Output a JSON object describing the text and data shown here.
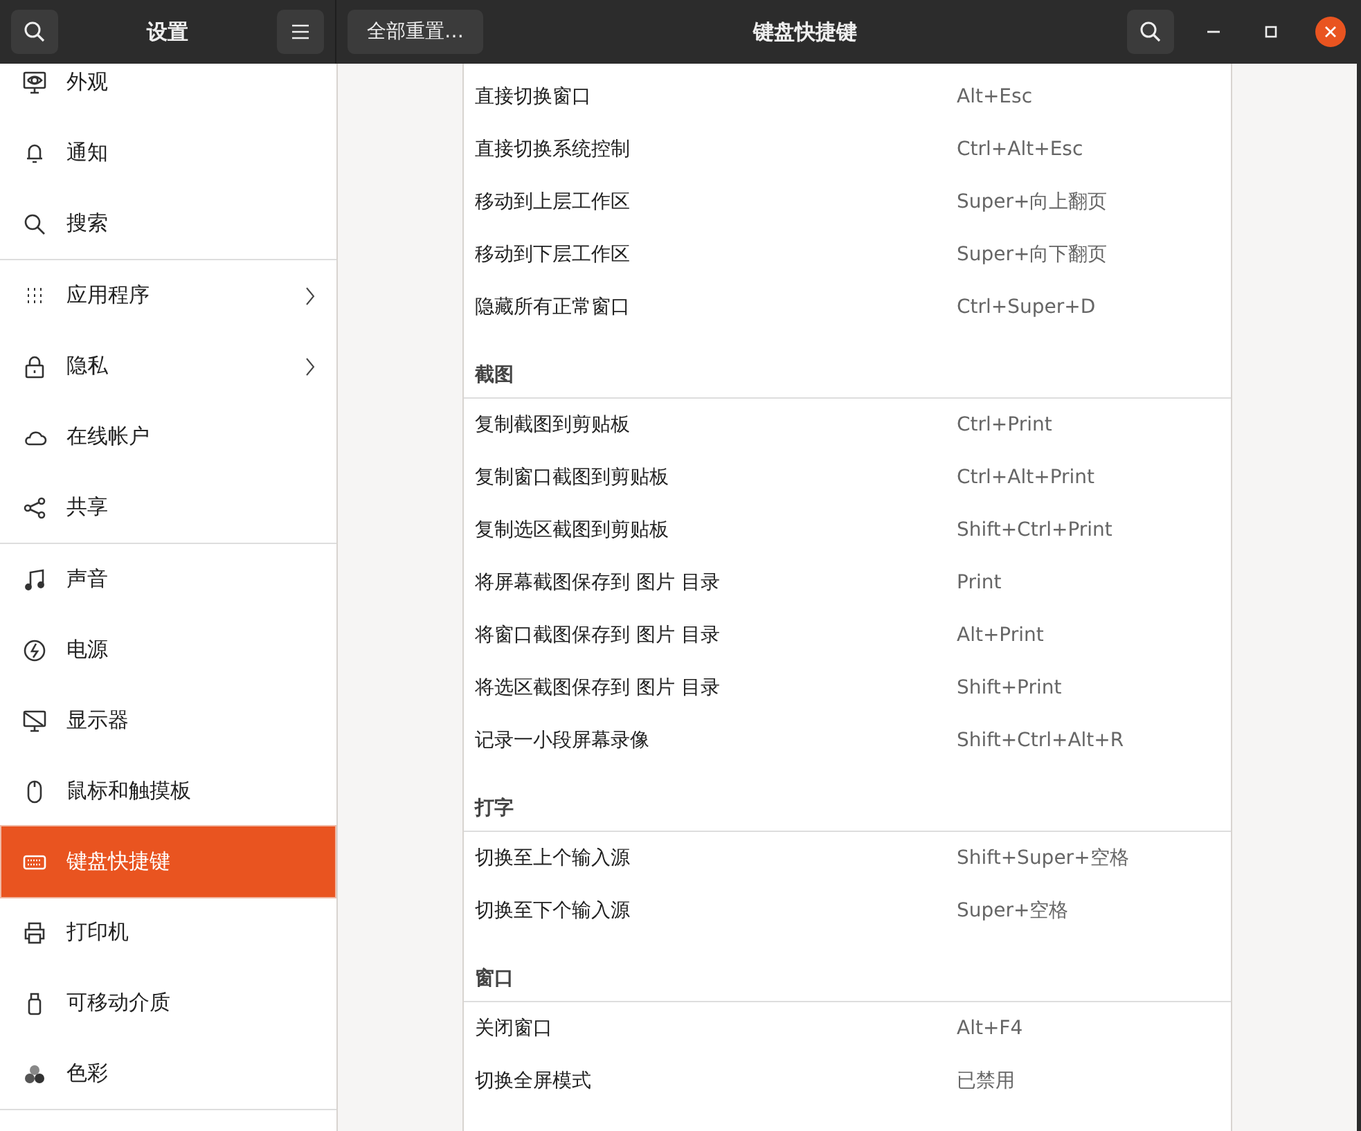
{
  "header": {
    "left_title": "设置",
    "reset_button": "全部重置…",
    "title": "键盘快捷键"
  },
  "sidebar": {
    "groups": [
      [
        {
          "label": "外观",
          "selected": false,
          "submenu": false
        },
        {
          "label": "通知",
          "selected": false,
          "submenu": false
        },
        {
          "label": "搜索",
          "selected": false,
          "submenu": false
        }
      ],
      [
        {
          "label": "应用程序",
          "selected": false,
          "submenu": true
        },
        {
          "label": "隐私",
          "selected": false,
          "submenu": true
        },
        {
          "label": "在线帐户",
          "selected": false,
          "submenu": false
        },
        {
          "label": "共享",
          "selected": false,
          "submenu": false
        }
      ],
      [
        {
          "label": "声音",
          "selected": false,
          "submenu": false
        },
        {
          "label": "电源",
          "selected": false,
          "submenu": false
        },
        {
          "label": "显示器",
          "selected": false,
          "submenu": false
        },
        {
          "label": "鼠标和触摸板",
          "selected": false,
          "submenu": false
        },
        {
          "label": "键盘快捷键",
          "selected": true,
          "submenu": false
        },
        {
          "label": "打印机",
          "selected": false,
          "submenu": false
        },
        {
          "label": "可移动介质",
          "selected": false,
          "submenu": false
        },
        {
          "label": "色彩",
          "selected": false,
          "submenu": false
        }
      ]
    ]
  },
  "sections": [
    {
      "rows": [
        {
          "action": "直接切换窗口",
          "shortcut": "Alt+Esc"
        },
        {
          "action": "直接切换系统控制",
          "shortcut": "Ctrl+Alt+Esc"
        },
        {
          "action": "移动到上层工作区",
          "shortcut": "Super+向上翻页"
        },
        {
          "action": "移动到下层工作区",
          "shortcut": "Super+向下翻页"
        },
        {
          "action": "隐藏所有正常窗口",
          "shortcut": "Ctrl+Super+D"
        }
      ]
    },
    {
      "title": "截图",
      "rows": [
        {
          "action": "复制截图到剪贴板",
          "shortcut": "Ctrl+Print"
        },
        {
          "action": "复制窗口截图到剪贴板",
          "shortcut": "Ctrl+Alt+Print"
        },
        {
          "action": "复制选区截图到剪贴板",
          "shortcut": "Shift+Ctrl+Print"
        },
        {
          "action": "将屏幕截图保存到 图片 目录",
          "shortcut": "Print"
        },
        {
          "action": "将窗口截图保存到 图片 目录",
          "shortcut": "Alt+Print"
        },
        {
          "action": "将选区截图保存到 图片 目录",
          "shortcut": "Shift+Print"
        },
        {
          "action": "记录一小段屏幕录像",
          "shortcut": "Shift+Ctrl+Alt+R"
        }
      ]
    },
    {
      "title": "打字",
      "rows": [
        {
          "action": "切换至上个输入源",
          "shortcut": "Shift+Super+空格"
        },
        {
          "action": "切换至下个输入源",
          "shortcut": "Super+空格"
        }
      ]
    },
    {
      "title": "窗口",
      "rows": [
        {
          "action": "关闭窗口",
          "shortcut": "Alt+F4"
        },
        {
          "action": "切换全屏模式",
          "shortcut": "已禁用"
        }
      ]
    }
  ]
}
